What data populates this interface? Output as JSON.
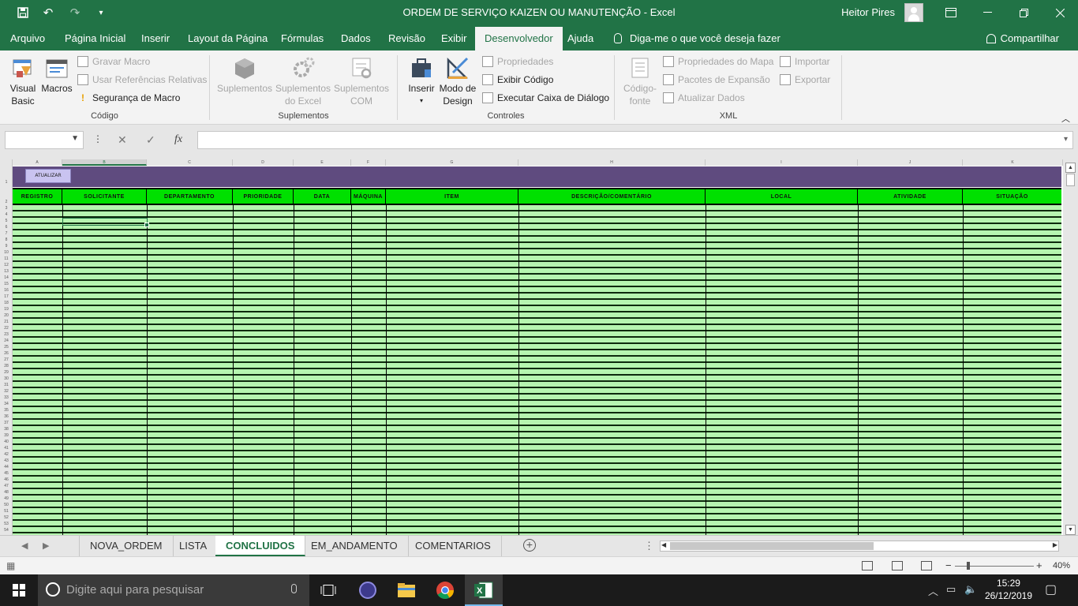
{
  "window": {
    "title": "ORDEM DE SERVIÇO KAIZEN OU MANUTENÇÃO  -  Excel",
    "user": "Heitor Pires",
    "qat": [
      "save-icon",
      "undo-icon",
      "redo-icon",
      "customize-qat-icon"
    ],
    "controls": [
      "ribbon-display-icon",
      "minimize-icon",
      "restore-icon",
      "close-icon"
    ]
  },
  "menu": {
    "tabs": [
      "Arquivo",
      "Página Inicial",
      "Inserir",
      "Layout da Página",
      "Fórmulas",
      "Dados",
      "Revisão",
      "Exibir",
      "Desenvolvedor",
      "Ajuda"
    ],
    "active_tab": "Desenvolvedor",
    "tell_me": "Diga-me o que você deseja fazer",
    "share": "Compartilhar"
  },
  "ribbon": {
    "codigo": {
      "label": "Código",
      "visual_basic": [
        "Visual",
        "Basic"
      ],
      "macros": "Macros",
      "gravar_macro": "Gravar Macro",
      "usar_referencias": "Usar Referências Relativas",
      "seguranca_macro": "Segurança de Macro"
    },
    "suplementos": {
      "label": "Suplementos",
      "suplementos": "Suplementos",
      "suplementos_excel": [
        "Suplementos",
        "do Excel"
      ],
      "suplementos_com": [
        "Suplementos",
        "COM"
      ]
    },
    "controles": {
      "label": "Controles",
      "inserir": "Inserir",
      "modo_design": [
        "Modo de",
        "Design"
      ],
      "propriedades": "Propriedades",
      "exibir_codigo": "Exibir Código",
      "executar_caixa": "Executar Caixa de Diálogo"
    },
    "xml": {
      "label": "XML",
      "codigo_fonte": [
        "Código-",
        "fonte"
      ],
      "propriedades_mapa": "Propriedades do Mapa",
      "pacotes_expansao": "Pacotes de Expansão",
      "atualizar_dados": "Atualizar Dados",
      "importar": "Importar",
      "exportar": "Exportar"
    }
  },
  "formula_bar": {
    "name_box": "",
    "cancel": "✕",
    "enter": "✓",
    "fx": "fx",
    "formula": ""
  },
  "sheet": {
    "columns": [
      "A",
      "B",
      "C",
      "D",
      "E",
      "F",
      "G",
      "H",
      "I",
      "J",
      "K"
    ],
    "selected_column": "B",
    "rows": [
      "1",
      "2",
      "3",
      "4",
      "5",
      "6",
      "7",
      "8",
      "9",
      "10",
      "11",
      "12",
      "13",
      "14",
      "15",
      "16",
      "17",
      "18",
      "19",
      "20",
      "21",
      "22",
      "23",
      "24",
      "25",
      "26",
      "27",
      "28",
      "29",
      "30",
      "31",
      "32",
      "33",
      "34",
      "35",
      "36",
      "37",
      "38",
      "39",
      "40",
      "41",
      "42",
      "43",
      "44",
      "45",
      "46",
      "47",
      "48",
      "49",
      "50",
      "51",
      "52",
      "53",
      "54"
    ],
    "button_label": "ATUALIZAR",
    "headers": [
      "REGISTRO",
      "SOLICITANTE",
      "DEPARTAMENTO",
      "PRIORIDADE",
      "DATA",
      "MÁQUINA",
      "ITEM",
      "DESCRIÇÃO/COMENTÁRIO",
      "LOCAL",
      "ATIVIDADE",
      "SITUAÇÃO"
    ],
    "colors": {
      "header_green": "#00e000",
      "row_green": "#b6f5b0",
      "band_purple": "#5f4b7f",
      "button": "#c9c3f0"
    }
  },
  "sheet_tabs": {
    "tabs": [
      "NOVA_ORDEM",
      "LISTA",
      "CONCLUIDOS",
      "EM_ANDAMENTO",
      "COMENTARIOS"
    ],
    "active": "CONCLUIDOS"
  },
  "status_bar": {
    "zoom": "40%",
    "zoom_minus": "−",
    "zoom_plus": "+"
  },
  "taskbar": {
    "search_placeholder": "Digite aqui para pesquisar",
    "time": "15:29",
    "date": "26/12/2019"
  },
  "accent": "#217346"
}
